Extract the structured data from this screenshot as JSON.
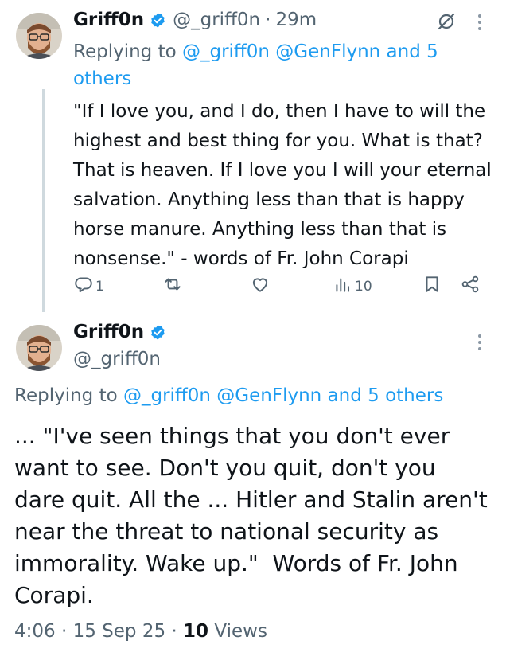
{
  "tweet1": {
    "author_name": "Griff0n",
    "handle": "@_griff0n",
    "separator": "·",
    "time": "29m",
    "replying_prefix": "Replying to ",
    "replying_mentions": "@_griff0n @GenFlynn and 5 others",
    "text": "\"If I love you, and I do, then I have to will the highest and best thing for you. What is that? That is heaven. If I love you I will your eternal salvation. Anything less than that is happy horse manure. Anything less than that is nonsense.\" - words of Fr. John Corapi",
    "reply_count": "1",
    "views_count": "10"
  },
  "tweet2": {
    "author_name": "Griff0n",
    "handle": "@_griff0n",
    "replying_prefix": "Replying to ",
    "replying_mentions": "@_griff0n @GenFlynn and 5 others",
    "text": "... \"I've seen things that you don't ever want to see. Don't you quit, don't you dare quit. All the ... Hitler and Stalin aren't near the threat to national security as immorality. Wake up.\"  Words of Fr. John Corapi.",
    "time": "4:06",
    "date": "15 Sep 25",
    "separator": "·",
    "views_count": "10",
    "views_label": "Views"
  },
  "colors": {
    "text": "#0f1419",
    "secondary": "#536471",
    "link": "#1d9bf0",
    "verified": "#1d9bf0"
  },
  "icons": [
    "verified-badge-icon",
    "grok-icon",
    "more-icon",
    "reply-icon",
    "retweet-icon",
    "like-icon",
    "views-icon",
    "bookmark-icon",
    "share-icon"
  ]
}
